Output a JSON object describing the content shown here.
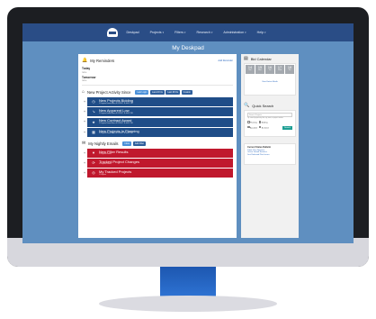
{
  "nav": {
    "items": [
      "Deskpad",
      "Projects",
      "Filters",
      "Research",
      "Administration",
      "Help"
    ]
  },
  "page": {
    "title": "My Deskpad"
  },
  "reminders": {
    "title": "My Reminders",
    "add_label": "Add Reminder",
    "today": {
      "label": "Today",
      "sub": "none"
    },
    "tomorrow": {
      "label": "Tomorrow",
      "sub": "none"
    }
  },
  "activity": {
    "title": "New Project Activity Since",
    "buttons": [
      "Last Login",
      "Last 24 hrs",
      "Last 48 hrs",
      "Custom"
    ],
    "items": [
      {
        "title": "New Projects Bidding",
        "sub": "1 Projects Found Since 8/17/2017 11:44:21 PM"
      },
      {
        "title": "New Apparent Low",
        "sub": "1 Projects Found Since 8/17/2017 11:44:21 PM"
      },
      {
        "title": "New Contract Award",
        "sub": "1 Projects Found Since 8/17/2017 11:44:21 PM"
      },
      {
        "title": "New Projects In Planning",
        "sub": "1 Projects Found Since 8/17/2017 11:44:21 PM"
      }
    ]
  },
  "nightly": {
    "title": "My Nightly Emails",
    "buttons": [
      "Inbox",
      "Add Filter"
    ],
    "items": [
      {
        "title": "New Filter Results",
        "sub": "1 Projects Found"
      },
      {
        "title": "Tracked Project Changes",
        "sub": "1 Projects Found"
      },
      {
        "title": "My Tracked Projects",
        "sub": "1 Projects"
      }
    ]
  },
  "calendar": {
    "title": "Bid Calendar",
    "days": [
      {
        "num": "14",
        "dow": "Sun"
      },
      {
        "num": "15",
        "dow": "Mon"
      },
      {
        "num": "16",
        "dow": "Tue"
      },
      {
        "num": "17",
        "dow": "Wed"
      },
      {
        "num": "18",
        "dow": "Thu"
      }
    ],
    "link": "View Entire Month"
  },
  "quick_search": {
    "title": "Quick Search",
    "placeholder": "Search Projects",
    "hint": "Tip: search projects by title, city, state, or project number",
    "options": [
      "Planning",
      "Bidding",
      "Awarded",
      "Archived"
    ],
    "button": "Search"
  },
  "current": {
    "title": "Current Status Bulletin",
    "links": [
      "Public Plan Room(s)",
      "Online Takeoff Services",
      "Just Released Plan Issues"
    ]
  },
  "colors": {
    "nav": "#2a4d86",
    "page_bg": "#5f8fc0",
    "bar_blue": "#1f4d88",
    "bar_red": "#c0182d",
    "accent": "#4a90d9",
    "search_btn": "#1e9f94"
  }
}
